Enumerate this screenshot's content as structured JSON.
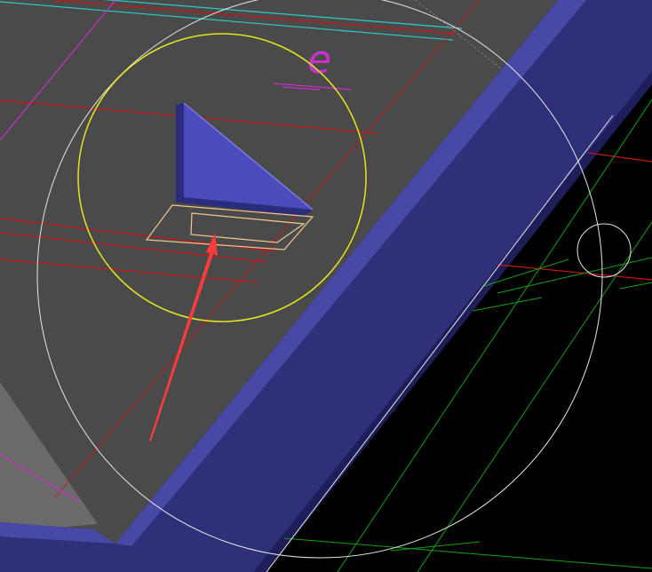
{
  "viewport": {
    "label": "cad-3d-viewport",
    "colors": {
      "background": "#000000",
      "plate_face": "#4a4a4a",
      "plate_lower": "#6a6a6a",
      "edge_band": "#30307a",
      "edge_band_highlight": "#4848a6",
      "edge_band_dark": "#1e1e5a",
      "triangle_face": "#4b4bbe",
      "triangle_side": "#2c2c7c",
      "triangle_top": "#7a7ae0",
      "highlight_circle": "#e6e61e",
      "outline_rect": "#f2c88c",
      "red_line": "#c81414",
      "cyan_line": "#32c8c8",
      "magenta_line": "#c832c8",
      "green_line": "#14a014",
      "white_line": "#e6e6e6",
      "pointer_arrow": "#ff3c3c"
    }
  },
  "annotation": {
    "handwritten_letter": "e"
  }
}
